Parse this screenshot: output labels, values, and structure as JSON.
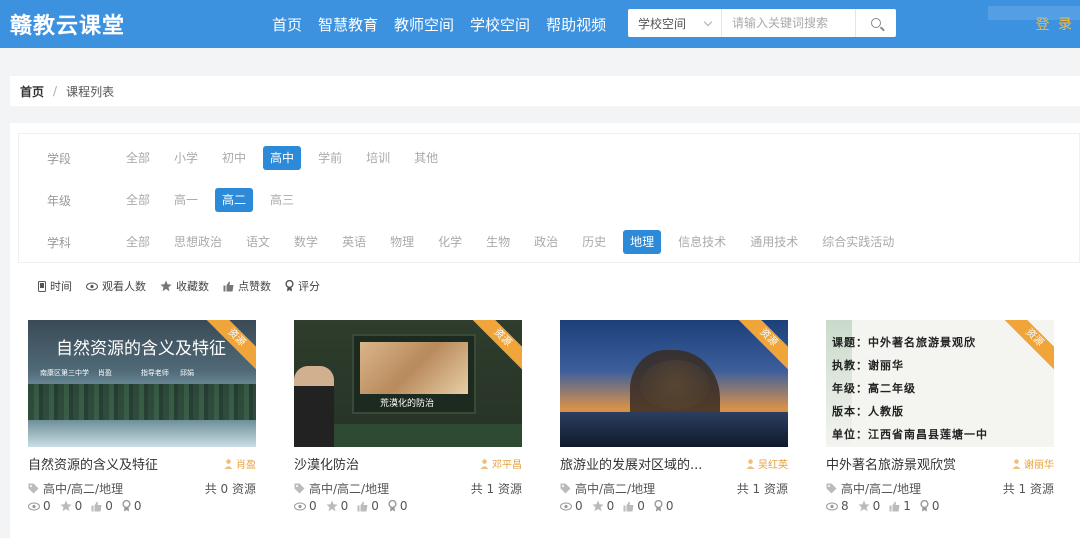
{
  "header": {
    "logo": "赣教云课堂",
    "nav": [
      "首页",
      "智慧教育",
      "教师空间",
      "学校空间",
      "帮助视频"
    ],
    "search_scope": "学校空间",
    "search_placeholder": "请输入关键词搜索",
    "login": "登 录"
  },
  "breadcrumb": {
    "home": "首页",
    "separator": "/",
    "current": "课程列表"
  },
  "filters": {
    "stage": {
      "label": "学段",
      "options": [
        "全部",
        "小学",
        "初中",
        "高中",
        "学前",
        "培训",
        "其他"
      ],
      "active": "高中"
    },
    "grade": {
      "label": "年级",
      "options": [
        "全部",
        "高一",
        "高二",
        "高三"
      ],
      "active": "高二"
    },
    "subject": {
      "label": "学科",
      "options": [
        "全部",
        "思想政治",
        "语文",
        "数学",
        "英语",
        "物理",
        "化学",
        "生物",
        "政治",
        "历史",
        "地理",
        "信息技术",
        "通用技术",
        "综合实践活动"
      ],
      "active": "地理"
    }
  },
  "sort": [
    "时间",
    "观看人数",
    "收藏数",
    "点赞数",
    "评分"
  ],
  "ribbon_label": "资源",
  "colors": {
    "header": "#3d92e0",
    "active": "#2d8ad8",
    "ribbon": "#f0a53a",
    "login": "#f5b942"
  },
  "cards": [
    {
      "title": "自然资源的含义及特征",
      "author": "肖盈",
      "tag": "高中/高二/地理",
      "count": "共 0 资源",
      "stats": {
        "views": "0",
        "favorites": "0",
        "likes": "0",
        "score": "0"
      },
      "thumb": {
        "title": "自然资源的含义及特征",
        "school": "南康区第三中学",
        "teacher": "肖盈",
        "advisor": "指导老师",
        "advisor_name": "邱娟"
      }
    },
    {
      "title": "沙漠化防治",
      "author": "邓平昌",
      "tag": "高中/高二/地理",
      "count": "共 1 资源",
      "stats": {
        "views": "0",
        "favorites": "0",
        "likes": "0",
        "score": "0"
      },
      "thumb": {
        "label": "荒漠化的防治"
      }
    },
    {
      "title": "旅游业的发展对区域的...",
      "author": "吴红英",
      "tag": "高中/高二/地理",
      "count": "共 1 资源",
      "stats": {
        "views": "0",
        "favorites": "0",
        "likes": "0",
        "score": "0"
      }
    },
    {
      "title": "中外著名旅游景观欣赏",
      "author": "谢丽华",
      "tag": "高中/高二/地理",
      "count": "共 1 资源",
      "stats": {
        "views": "8",
        "favorites": "0",
        "likes": "1",
        "score": "0"
      },
      "thumb": {
        "lines": [
          "课题：中外著名旅游景观欣",
          "执教：谢丽华",
          "年级：高二年级",
          "版本：人教版",
          "单位：江西省南昌县莲塘一中"
        ]
      }
    }
  ]
}
